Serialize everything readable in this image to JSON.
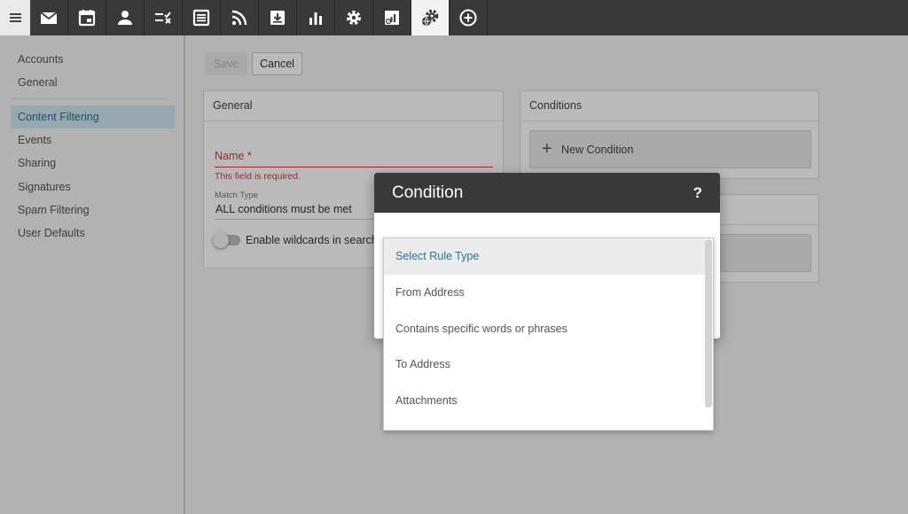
{
  "toolbar": {
    "menu": "menu-icon",
    "tools": [
      {
        "name": "mail-icon"
      },
      {
        "name": "calendar-icon"
      },
      {
        "name": "contacts-icon"
      },
      {
        "name": "tasks-icon"
      },
      {
        "name": "notes-icon"
      },
      {
        "name": "rss-icon"
      },
      {
        "name": "download-icon"
      },
      {
        "name": "reports-icon"
      },
      {
        "name": "settings-icon"
      },
      {
        "name": "domain-reports-icon"
      },
      {
        "name": "domain-settings-icon",
        "active": true
      },
      {
        "name": "add-icon"
      }
    ]
  },
  "sidebar": {
    "items": [
      {
        "label": "Accounts"
      },
      {
        "label": "General"
      },
      {
        "label": "Content Filtering",
        "active": true
      },
      {
        "label": "Events"
      },
      {
        "label": "Sharing"
      },
      {
        "label": "Signatures"
      },
      {
        "label": "Spam Filtering"
      },
      {
        "label": "User Defaults"
      }
    ]
  },
  "actions": {
    "save_label": "Save",
    "cancel_label": "Cancel"
  },
  "general_panel": {
    "title": "General",
    "name_label": "Name *",
    "name_error": "This field is required.",
    "match_type_label": "Match Type",
    "match_type_value": "ALL conditions must be met",
    "wildcard_label": "Enable wildcards in search strings",
    "wildcard_enabled": false
  },
  "conditions_panel": {
    "title": "Conditions",
    "new_condition_label": "New Condition"
  },
  "modal": {
    "title": "Condition",
    "help": "?"
  },
  "rule_dropdown": {
    "selected": "Select Rule Type",
    "options": [
      "Select Rule Type",
      "From Address",
      "Contains specific words or phrases",
      "To Address",
      "Attachments"
    ]
  },
  "colors": {
    "toolbar_bg": "#393939",
    "accent": "#2a6f9a",
    "active_nav_bg": "#cfe6f3",
    "error": "#d23c3c"
  }
}
